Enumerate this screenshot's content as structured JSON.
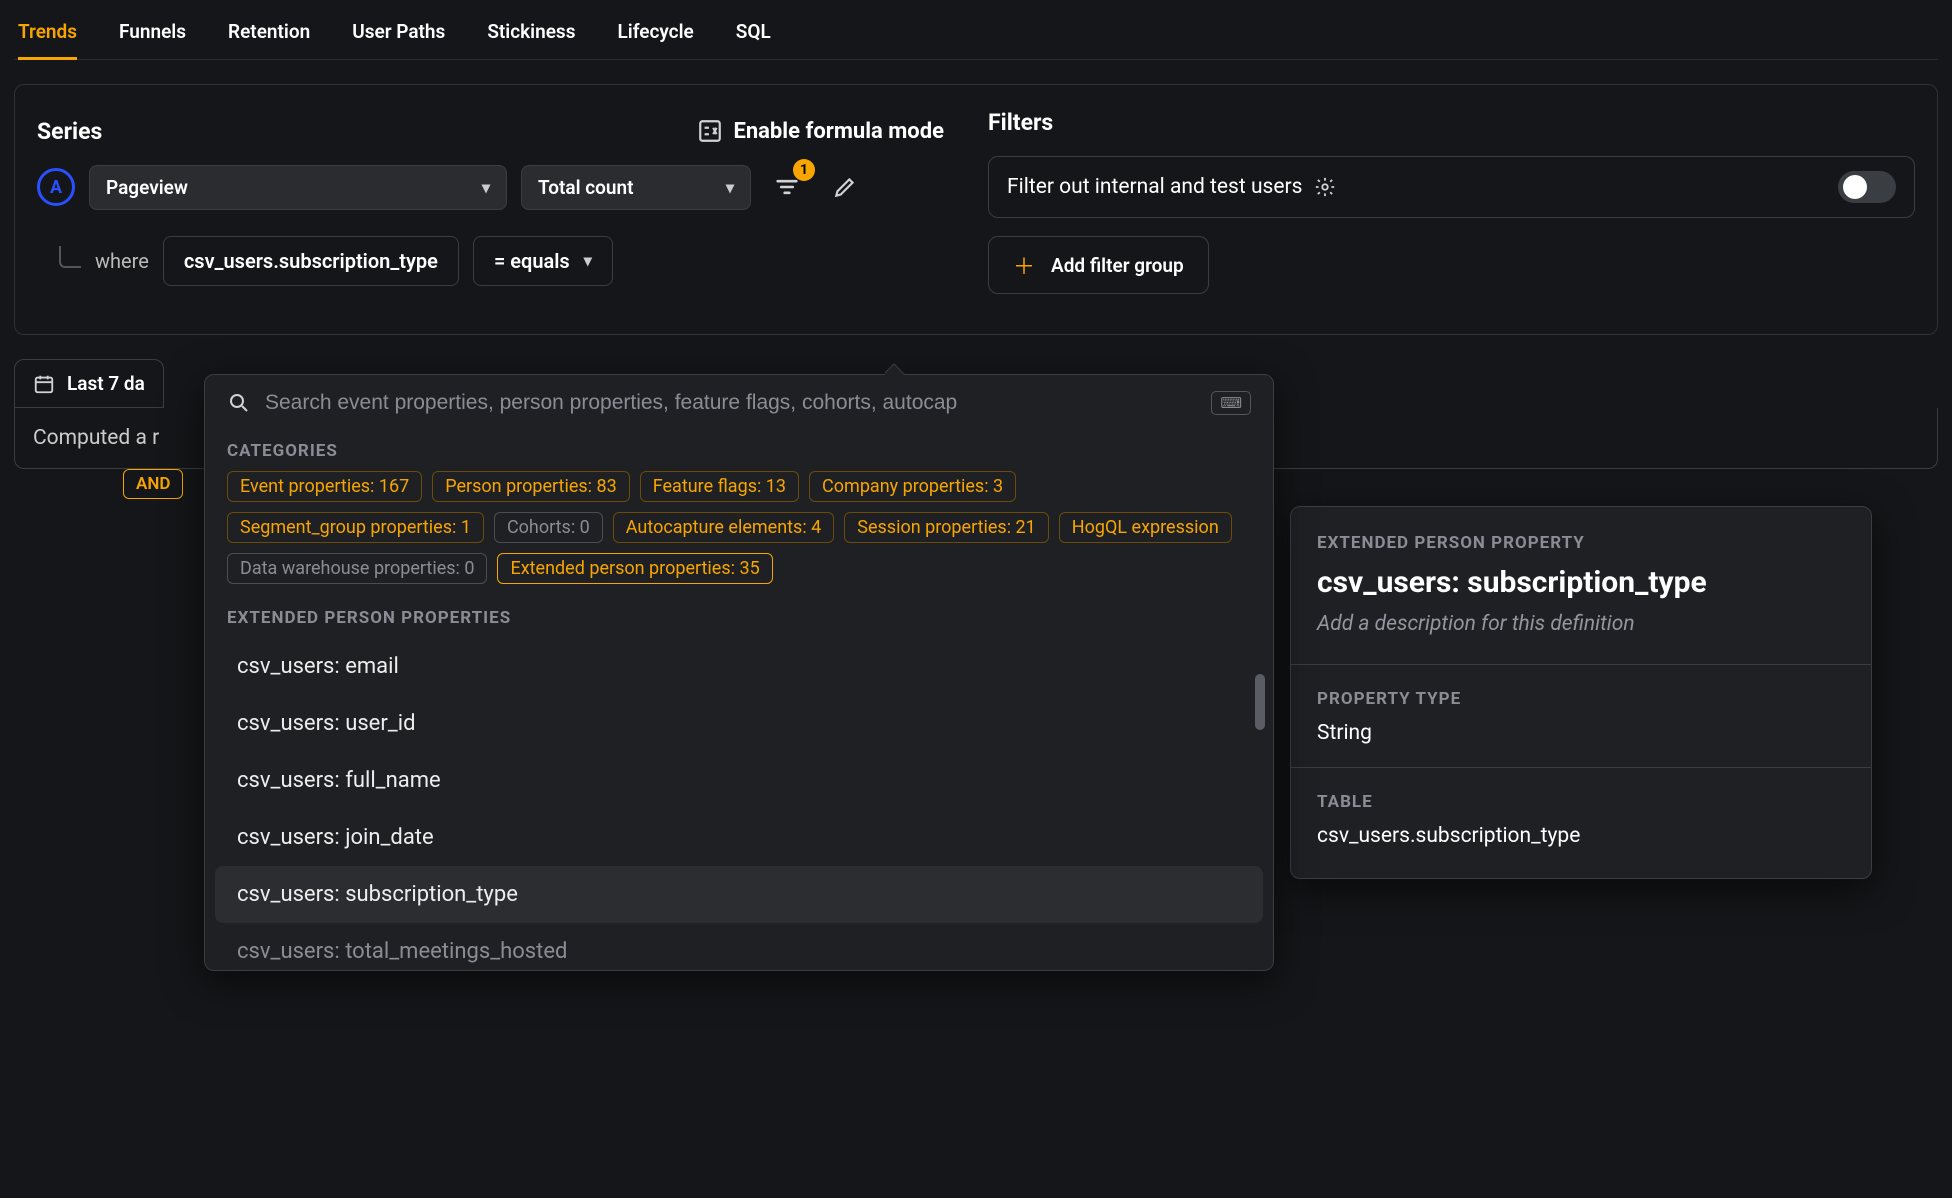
{
  "tabs": [
    "Trends",
    "Funnels",
    "Retention",
    "User Paths",
    "Stickiness",
    "Lifecycle",
    "SQL"
  ],
  "active_tab": 0,
  "series": {
    "title": "Series",
    "badge_letter": "A",
    "event": "Pageview",
    "aggregation": "Total count",
    "filter_badge_count": "1",
    "formula_label": "Enable formula mode",
    "where_label": "where",
    "where_property": "csv_users.subscription_type",
    "where_operator": "= equals",
    "logic_chip": "AND"
  },
  "filters": {
    "title": "Filters",
    "toggle_label": "Filter out internal and test users",
    "add_group_label": "Add filter group"
  },
  "date_range": {
    "label_visible": "Last 7 da"
  },
  "computed_visible": "Computed a r",
  "popover": {
    "search_placeholder": "Search event properties, person properties, feature flags, cohorts, autocap",
    "categories_header": "CATEGORIES",
    "pills": [
      {
        "label": "Event properties: 167",
        "muted": false
      },
      {
        "label": "Person properties: 83",
        "muted": false
      },
      {
        "label": "Feature flags: 13",
        "muted": false
      },
      {
        "label": "Company properties: 3",
        "muted": false
      },
      {
        "label": "Segment_group properties: 1",
        "muted": false
      },
      {
        "label": "Cohorts: 0",
        "muted": true
      },
      {
        "label": "Autocapture elements: 4",
        "muted": false
      },
      {
        "label": "Session properties: 21",
        "muted": false
      },
      {
        "label": "HogQL expression",
        "muted": false
      },
      {
        "label": "Data warehouse properties: 0",
        "muted": true
      },
      {
        "label": "Extended person properties: 35",
        "muted": false,
        "selected": true
      }
    ],
    "list_header": "EXTENDED PERSON PROPERTIES",
    "items": [
      "csv_users: email",
      "csv_users: user_id",
      "csv_users: full_name",
      "csv_users: join_date",
      "csv_users: subscription_type",
      "csv_users: total_meetings_hosted"
    ],
    "highlighted_index": 4
  },
  "detail": {
    "category_label": "EXTENDED PERSON PROPERTY",
    "title": "csv_users: subscription_type",
    "description_placeholder": "Add a description for this definition",
    "type_label": "PROPERTY TYPE",
    "type_value": "String",
    "table_label": "TABLE",
    "table_value": "csv_users.subscription_type"
  }
}
